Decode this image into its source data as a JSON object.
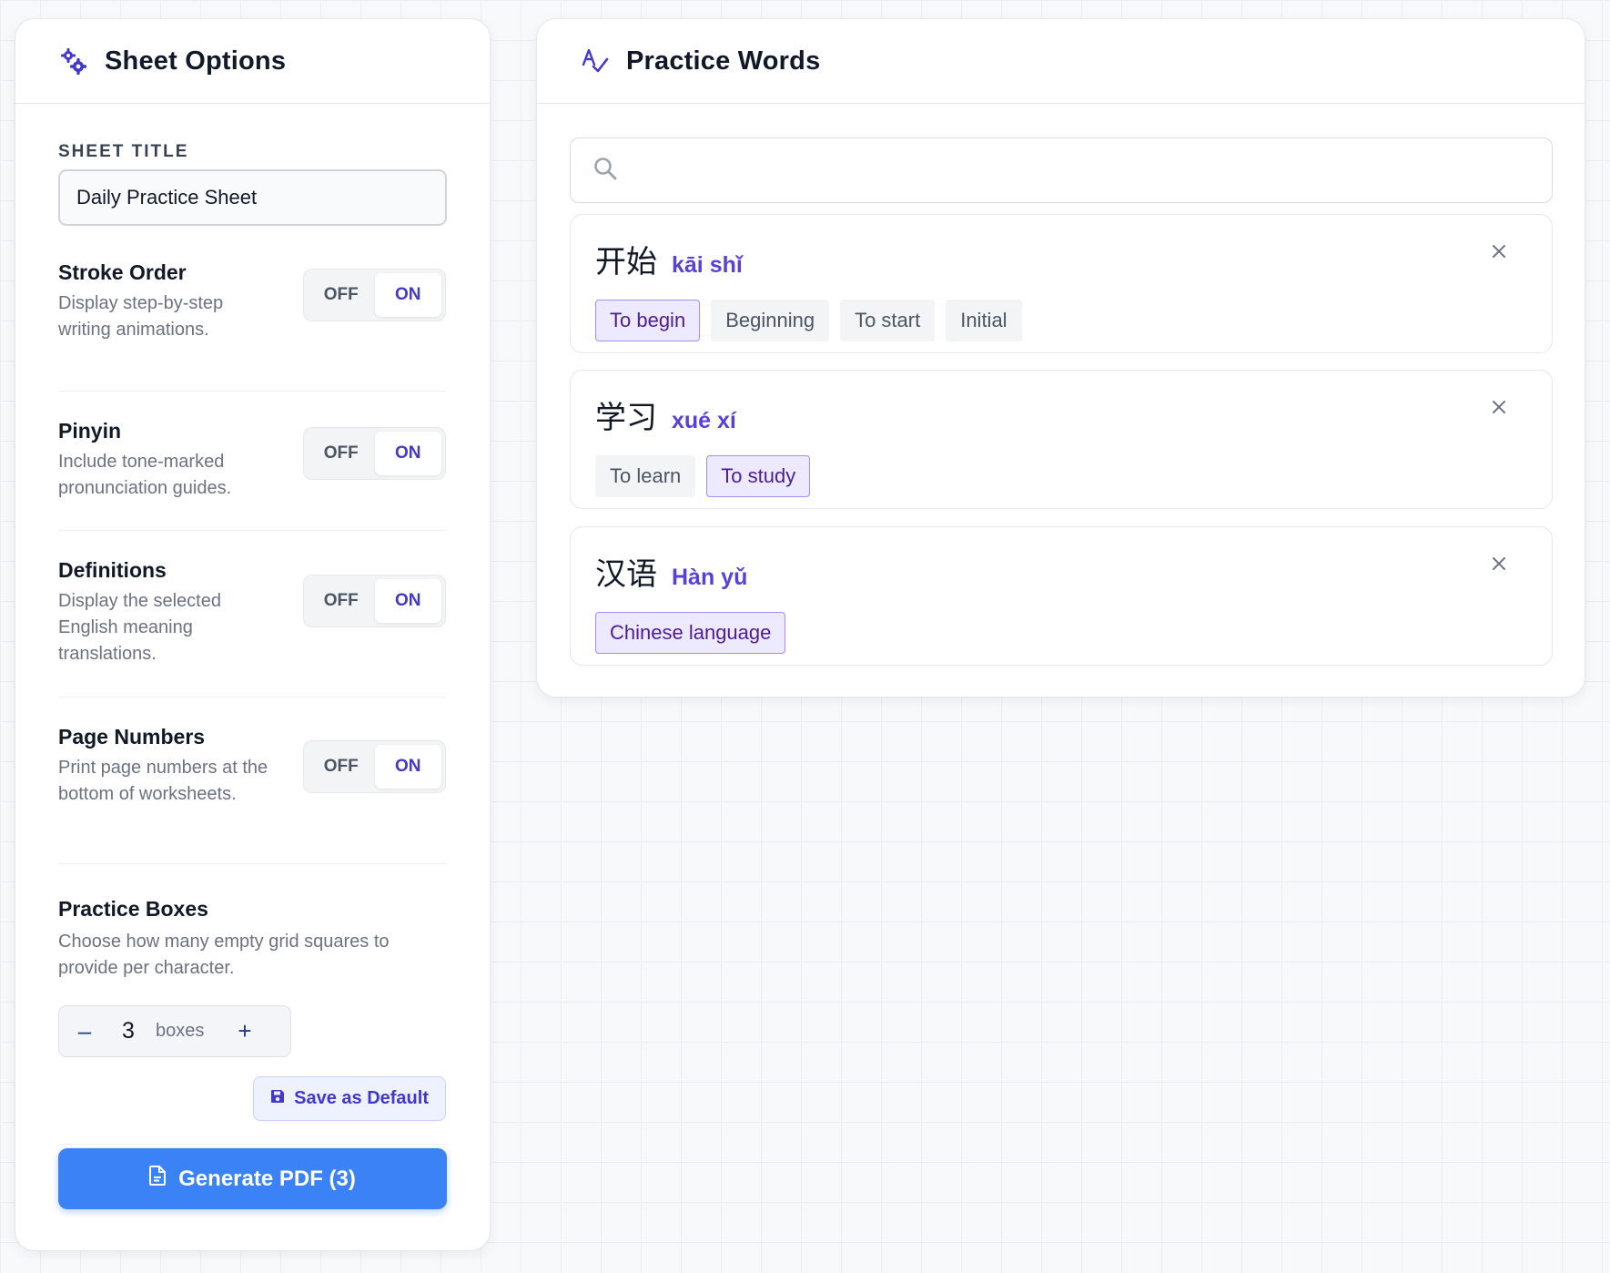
{
  "sheet_options": {
    "header_title": "Sheet Options",
    "title_label": "SHEET TITLE",
    "title_value": "Daily Practice Sheet",
    "options": [
      {
        "title": "Stroke Order",
        "description": "Display step-by-step writing animations.",
        "off_label": "OFF",
        "on_label": "ON",
        "state": "ON"
      },
      {
        "title": "Pinyin",
        "description": "Include tone-marked pronunciation guides.",
        "off_label": "OFF",
        "on_label": "ON",
        "state": "ON"
      },
      {
        "title": "Definitions",
        "description": "Display the selected English meaning translations.",
        "off_label": "OFF",
        "on_label": "ON",
        "state": "ON"
      },
      {
        "title": "Page Numbers",
        "description": "Print page numbers at the bottom of worksheets.",
        "off_label": "OFF",
        "on_label": "ON",
        "state": "ON"
      }
    ],
    "practice_boxes": {
      "title": "Practice Boxes",
      "description": "Choose how many empty grid squares to provide per character.",
      "minus": "–",
      "value": "3",
      "unit": "boxes",
      "plus": "+"
    },
    "save_default_label": "Save as Default",
    "generate_label": "Generate PDF (3)"
  },
  "practice_words": {
    "header_title": "Practice Words",
    "search": {
      "placeholder": "",
      "value": ""
    },
    "words": [
      {
        "hanzi": "开始",
        "pinyin": "kāi shǐ",
        "meanings": [
          {
            "text": "To begin",
            "selected": true
          },
          {
            "text": "Beginning",
            "selected": false
          },
          {
            "text": "To start",
            "selected": false
          },
          {
            "text": "Initial",
            "selected": false
          }
        ]
      },
      {
        "hanzi": "学习",
        "pinyin": "xué xí",
        "meanings": [
          {
            "text": "To learn",
            "selected": false
          },
          {
            "text": "To study",
            "selected": true
          }
        ]
      },
      {
        "hanzi": "汉语",
        "pinyin": "Hàn yǔ",
        "meanings": [
          {
            "text": "Chinese language",
            "selected": true
          }
        ]
      }
    ]
  },
  "colors": {
    "accent": "#4338ca",
    "primary_button": "#3b82f6",
    "pinyin": "#5b3fd9",
    "selected_chip_bg": "#ede9fe",
    "selected_chip_border": "#a78bfa"
  },
  "icons": {
    "sheet_options": "gears-icon",
    "practice_words": "spell-check-icon",
    "search": "search-icon",
    "remove": "close-icon",
    "save": "floppy-disk-icon",
    "generate": "file-pdf-icon"
  }
}
